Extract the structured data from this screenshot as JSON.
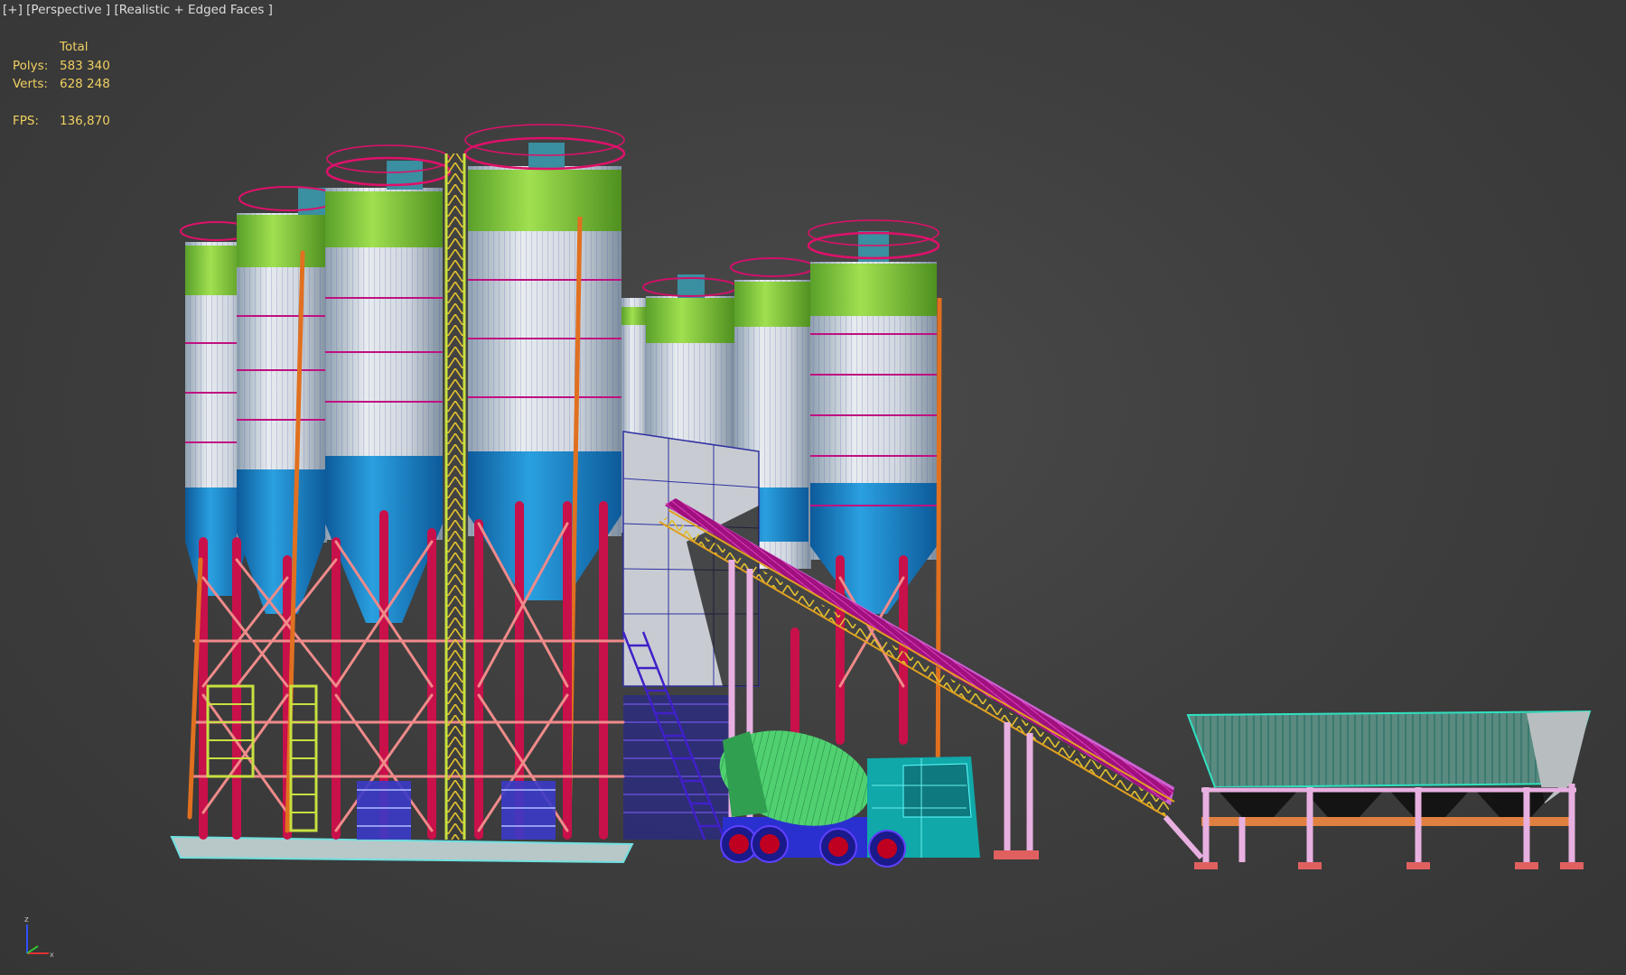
{
  "viewport": {
    "menu_plus": "[+]",
    "view_name": "[Perspective ]",
    "shading_mode": "[Realistic + Edged Faces ]"
  },
  "statistics": {
    "column_header": "Total",
    "polys_label": "Polys:",
    "polys_value": "583 340",
    "verts_label": "Verts:",
    "verts_value": "628 248",
    "fps_label": "FPS:",
    "fps_value": "136,870"
  },
  "gizmo": {
    "z_label": "z",
    "x_label": "x"
  },
  "colors": {
    "background": "#3f3f3f",
    "silo_top": "#7ed040",
    "silo_body": "#d8dde4",
    "silo_band": "#1a80c8",
    "frame_red": "#c8104a",
    "bracing_pink": "#f08080",
    "ladder_yellow": "#c8e040",
    "conveyor_magenta": "#a8108a",
    "truck_green": "#40d060",
    "truck_cab": "#10a0a0",
    "hopper_teal": "#30a890"
  },
  "scene_objects": [
    "silos",
    "ladder",
    "mixing-tower",
    "belt-conveyor",
    "mixer-truck",
    "aggregate-bins"
  ]
}
